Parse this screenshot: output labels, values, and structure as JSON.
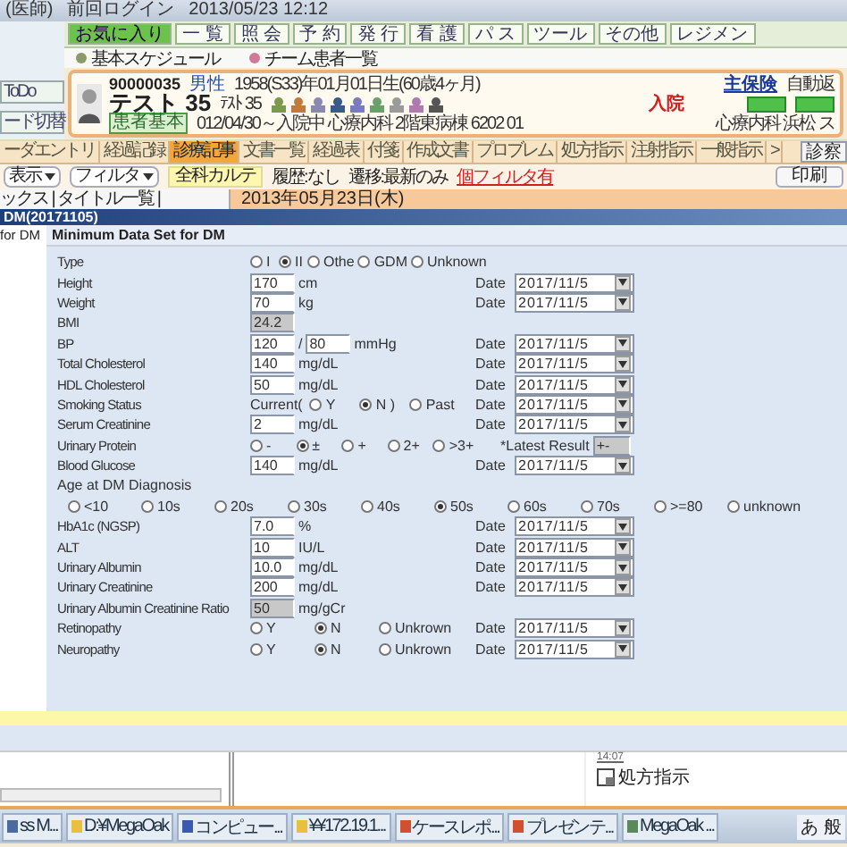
{
  "title_bar": {
    "role": "(医師)",
    "login_label": "前回ログイン",
    "login_time": "2013/05/23 12:12"
  },
  "menu": [
    {
      "label": "お気に入り",
      "selected": true
    },
    {
      "label": "一 覧",
      "selected": false
    },
    {
      "label": "照 会",
      "selected": false
    },
    {
      "label": "予 約",
      "selected": false
    },
    {
      "label": "発 行",
      "selected": false
    },
    {
      "label": "看 護",
      "selected": false
    },
    {
      "label": "パ ス",
      "selected": false
    },
    {
      "label": "ツール",
      "selected": false
    },
    {
      "label": "その他",
      "selected": false
    },
    {
      "label": "レジメン",
      "selected": false
    }
  ],
  "toolbar": [
    "基本スケジュール",
    "チーム患者一覧"
  ],
  "side": {
    "todo": "ToDo",
    "switch": "ード切替"
  },
  "patient": {
    "id": "90000035",
    "sex": "男性",
    "birth": "1958(S33)年01月01日生(60歳4ヶ月)",
    "name": "テスト 35",
    "kana": "ﾃｽﾄ 35",
    "status": "入院",
    "tag": "患者基本",
    "admission": "012/04/30～入院中 心療内科 2階東病棟 6202 01",
    "insurance": "主保険",
    "insurance_note": "自動返",
    "dept": "心療内科 浜松 ス"
  },
  "tabs": [
    {
      "label": "ーダエントリ",
      "selected": false
    },
    {
      "label": "経過記録",
      "selected": false
    },
    {
      "label": "診療記事",
      "selected": true
    },
    {
      "label": "文書一覧",
      "selected": false
    },
    {
      "label": "経過表",
      "selected": false
    },
    {
      "label": "付箋",
      "selected": false
    },
    {
      "label": "作成文書",
      "selected": false
    },
    {
      "label": "プロブレム",
      "selected": false
    },
    {
      "label": "処方指示",
      "selected": false
    },
    {
      "label": "注射指示",
      "selected": false
    },
    {
      "label": "一般指示",
      "selected": false
    },
    {
      "label": ">",
      "selected": false
    }
  ],
  "exam_button": "診察",
  "filter_bar": {
    "view": "表示",
    "filter": "フィルタ",
    "all": "全科カルテ",
    "history": "履歴:なし",
    "transition": "遷移:最新のみ",
    "personal_filter": "個フィルタ有",
    "print": "印刷"
  },
  "list_tabs": "ックス | タイトル一覧 |",
  "date_header": "2013年05月23日(木)",
  "dialog": {
    "title": "DM(20171105)",
    "side_tab": "for DM",
    "heading": "Minimum Data Set for DM",
    "rows": [
      {
        "kind": "radio",
        "label": "Type",
        "options": [
          {
            "label": "I",
            "selected": false
          },
          {
            "label": "II",
            "selected": true
          },
          {
            "label": "Othe",
            "selected": false
          },
          {
            "label": "GDM",
            "selected": false
          },
          {
            "label": "Unknown",
            "selected": false
          }
        ]
      },
      {
        "kind": "measure",
        "label": "Height",
        "value": "170",
        "unit": "cm",
        "date_label": "Date",
        "date": "2017/11/5"
      },
      {
        "kind": "measure",
        "label": "Weight",
        "value": "70",
        "unit": "kg",
        "date_label": "Date",
        "date": "2017/11/5"
      },
      {
        "kind": "measure",
        "label": "BMI",
        "value": "24.2",
        "readonly": true
      },
      {
        "kind": "bp",
        "label": "BP",
        "value": "120",
        "separator": "/",
        "value2": "80",
        "unit": "mmHg",
        "date_label": "Date",
        "date": "2017/11/5"
      },
      {
        "kind": "measure",
        "label": "Total Cholesterol",
        "value": "140",
        "unit": "mg/dL",
        "date_label": "Date",
        "date": "2017/11/5"
      },
      {
        "kind": "measure",
        "label": "HDL Cholesterol",
        "value": "50",
        "unit": "mg/dL",
        "date_label": "Date",
        "date": "2017/11/5"
      },
      {
        "kind": "smoking",
        "label": "Smoking Status",
        "prefix": "Current(",
        "options": [
          {
            "label": "Y",
            "selected": false
          },
          {
            "label": "N )",
            "selected": true
          },
          {
            "label": "Past",
            "selected": false
          }
        ],
        "date_label": "Date",
        "date": "2017/11/5"
      },
      {
        "kind": "measure",
        "label": "Serum Creatinine",
        "value": "2",
        "unit": "mg/dL",
        "date_label": "Date",
        "date": "2017/11/5"
      },
      {
        "kind": "protein",
        "label": "Urinary Protein",
        "options": [
          {
            "label": "-",
            "selected": false
          },
          {
            "label": "±",
            "selected": true
          },
          {
            "label": "+",
            "selected": false
          },
          {
            "label": "2+",
            "selected": false
          },
          {
            "label": ">3+",
            "selected": false
          }
        ],
        "latest_label": "*Latest Result",
        "latest_value": "+-"
      },
      {
        "kind": "measure",
        "label": "Blood Glucose",
        "value": "140",
        "unit": "mg/dL",
        "date_label": "Date",
        "date": "2017/11/5"
      },
      {
        "kind": "heading",
        "label": "Age at DM Diagnosis"
      },
      {
        "kind": "age",
        "options": [
          {
            "label": "<10",
            "selected": false
          },
          {
            "label": "10s",
            "selected": false
          },
          {
            "label": "20s",
            "selected": false
          },
          {
            "label": "30s",
            "selected": false
          },
          {
            "label": "40s",
            "selected": false
          },
          {
            "label": "50s",
            "selected": true
          },
          {
            "label": "60s",
            "selected": false
          },
          {
            "label": "70s",
            "selected": false
          },
          {
            "label": ">=80",
            "selected": false
          },
          {
            "label": "unknown",
            "selected": false
          }
        ]
      },
      {
        "kind": "measure",
        "label": "HbA1c (NGSP)",
        "value": "7.0",
        "unit": "%",
        "date_label": "Date",
        "date": "2017/11/5"
      },
      {
        "kind": "measure",
        "label": "ALT",
        "value": "10",
        "unit": "IU/L",
        "date_label": "Date",
        "date": "2017/11/5"
      },
      {
        "kind": "measure",
        "label": "Urinary Albumin",
        "value": "10.0",
        "unit": "mg/dL",
        "date_label": "Date",
        "date": "2017/11/5"
      },
      {
        "kind": "measure",
        "label": "Urinary Creatinine",
        "value": "200",
        "unit": "mg/dL",
        "date_label": "Date",
        "date": "2017/11/5"
      },
      {
        "kind": "measure",
        "label": "Urinary Albumin Creatinine Ratio",
        "value": "50",
        "unit": "mg/gCr",
        "readonly": true
      },
      {
        "kind": "yn",
        "label": "Retinopathy",
        "options": [
          {
            "label": "Y",
            "selected": false
          },
          {
            "label": "N",
            "selected": true
          },
          {
            "label": "Unkrown",
            "selected": false
          }
        ],
        "date_label": "Date",
        "date": "2017/11/5"
      },
      {
        "kind": "yn",
        "label": "Neuropathy",
        "options": [
          {
            "label": "Y",
            "selected": false
          },
          {
            "label": "N",
            "selected": true
          },
          {
            "label": "Unkrown",
            "selected": false
          }
        ],
        "date_label": "Date",
        "date": "2017/11/5"
      }
    ]
  },
  "lower": {
    "time": "14:07",
    "order": "処方指示"
  },
  "taskbar": {
    "items": [
      "ss M...",
      "D:¥MegaOak",
      "コンピュー...",
      "¥¥172.19.1...",
      "ケースレポ...",
      "プレゼンテ...",
      "MegaOak ..."
    ],
    "tray": "あ 般"
  }
}
